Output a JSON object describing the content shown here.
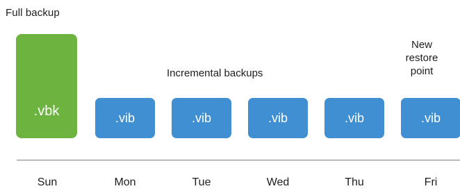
{
  "labels": {
    "full_backup": "Full backup",
    "incremental_backups": "Incremental backups",
    "new_restore_point": [
      "New",
      "restore",
      "point"
    ]
  },
  "files": {
    "full": ".vbk",
    "incremental": [
      ".vib",
      ".vib",
      ".vib",
      ".vib",
      ".vib"
    ]
  },
  "days": [
    "Sun",
    "Mon",
    "Tue",
    "Wed",
    "Thu",
    "Fri"
  ],
  "colors": {
    "full_backup": "#6db33f",
    "incremental_backup": "#3f8fd2",
    "timeline": "#7d7d7d"
  }
}
